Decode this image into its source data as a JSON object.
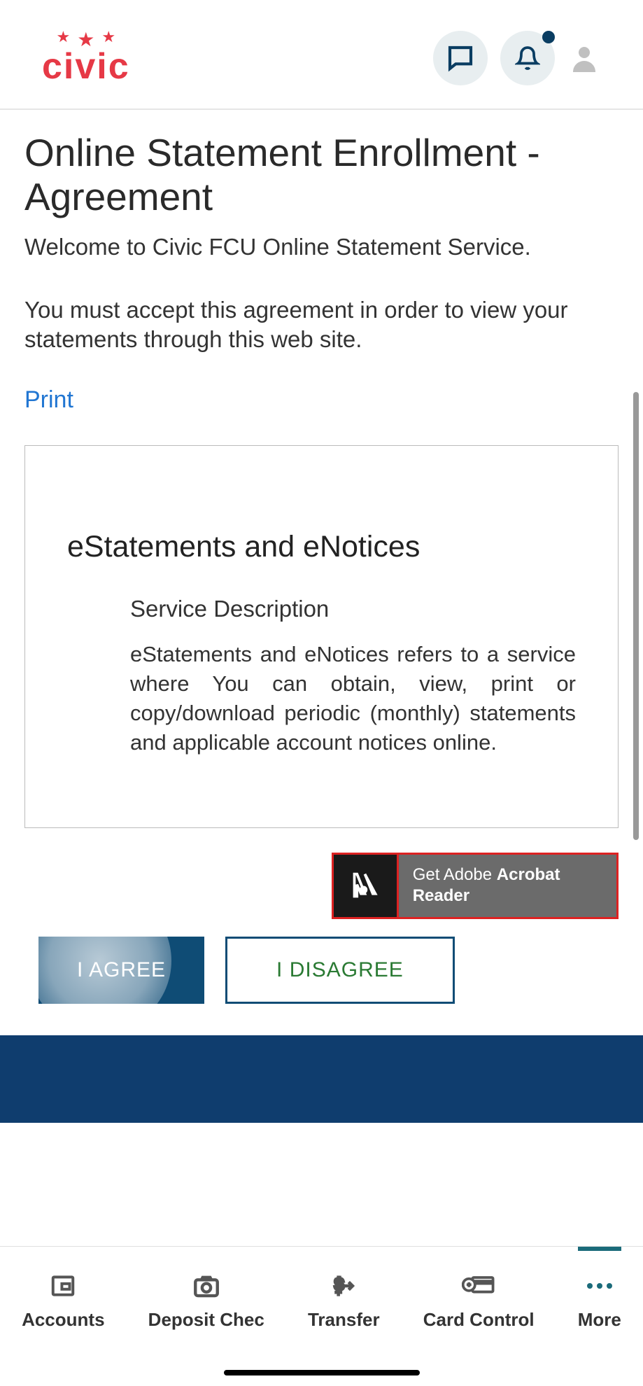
{
  "header": {
    "logo_text": "civic"
  },
  "page": {
    "title": "Online Statement Enrollment - Agreement",
    "welcome": "Welcome to Civic FCU Online Statement Service.",
    "instruction": "You must accept this agreement in order to view your statements through this web site.",
    "print": "Print"
  },
  "agreement": {
    "heading": "eStatements and eNotices",
    "subheading": "Service Description",
    "body": "eStatements and eNotices refers to a service where You can obtain, view, print or copy/download periodic (monthly) statements and applicable account notices online."
  },
  "adobe": {
    "line1": "Get Adobe",
    "line2": "Acrobat Reader"
  },
  "buttons": {
    "agree": "I AGREE",
    "disagree": "I DISAGREE"
  },
  "nav": {
    "accounts": "Accounts",
    "deposit": "Deposit Chec",
    "transfer": "Transfer",
    "cardcontrol": "Card Control",
    "more": "More"
  }
}
